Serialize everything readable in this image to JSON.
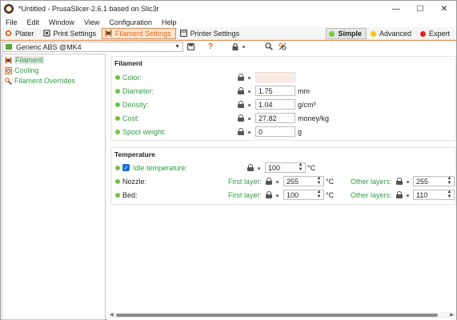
{
  "window": {
    "title": "*Untitled - PrusaSlicer-2.6.1 based on Slic3r"
  },
  "menu": [
    "File",
    "Edit",
    "Window",
    "View",
    "Configuration",
    "Help"
  ],
  "tabs": [
    {
      "label": "Plater"
    },
    {
      "label": "Print Settings"
    },
    {
      "label": "Filament Settings"
    },
    {
      "label": "Printer Settings"
    }
  ],
  "modes": [
    {
      "label": "Simple",
      "color": "#7ac943"
    },
    {
      "label": "Advanced",
      "color": "#f1c40f"
    },
    {
      "label": "Expert",
      "color": "#e0231c"
    }
  ],
  "preset": {
    "name": "Generic ABS @MK4"
  },
  "tree": [
    {
      "label": "Filament",
      "icon": "spool-icon"
    },
    {
      "label": "Cooling",
      "icon": "fan-icon"
    },
    {
      "label": "Filament Overrides",
      "icon": "wrench-icon"
    }
  ],
  "filament": {
    "title": "Filament",
    "rows": [
      {
        "label": "Color:",
        "value": "",
        "unit": ""
      },
      {
        "label": "Diameter:",
        "value": "1.75",
        "unit": "mm"
      },
      {
        "label": "Density:",
        "value": "1.04",
        "unit": "g/cm³"
      },
      {
        "label": "Cost:",
        "value": "27.82",
        "unit": "money/kg"
      },
      {
        "label": "Spool weight:",
        "value": "0",
        "unit": "g"
      }
    ]
  },
  "temperature": {
    "title": "Temperature",
    "idle": {
      "label": "Idle temperature:",
      "value": "100",
      "unit": "°C"
    },
    "first_layer": "First layer:",
    "other_layers": "Other layers:",
    "nozzle": {
      "label": "Nozzle:",
      "first": "255",
      "first_unit": "°C",
      "other": "255"
    },
    "bed": {
      "label": "Bed:",
      "first": "100",
      "first_unit": "°C",
      "other": "110"
    }
  },
  "colors": {
    "accent": "#e06a1c",
    "green": "#2f9e3f",
    "color_swatch": "#fbece3"
  }
}
